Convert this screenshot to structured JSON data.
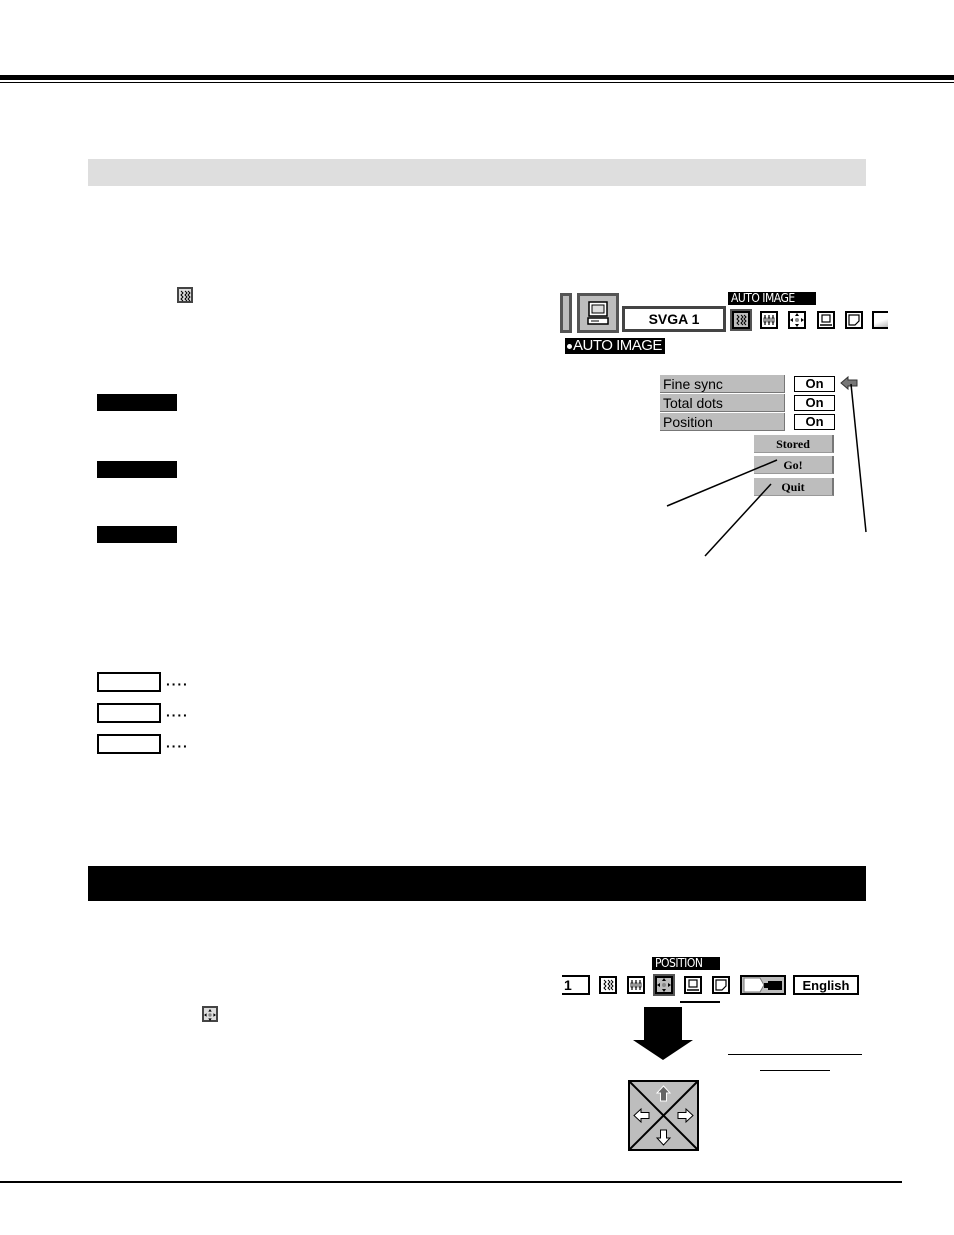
{
  "page": {
    "section_band_top": {
      "label": ""
    },
    "section_band_bottom": {
      "label": ""
    }
  },
  "auto_image_section": {
    "inline_icon": "fine-sync-icon",
    "label_blocks": [
      "",
      "",
      ""
    ],
    "legend_boxes": [
      {
        "box_label": "",
        "leader": "····"
      },
      {
        "box_label": "",
        "leader": "····"
      },
      {
        "box_label": "",
        "leader": "····"
      }
    ],
    "osd": {
      "menu_title": "AUTO IMAGE",
      "source_label": "SVGA 1",
      "submenu_title": "AUTO IMAGE",
      "toolbar_icons": [
        "pc-adjust-icon",
        "fine-sync-icon",
        "total-dots-icon",
        "position-icon",
        "image-level-icon",
        "screen-icon",
        "setting-icon"
      ],
      "rows": [
        {
          "label": "Fine sync",
          "value": "On"
        },
        {
          "label": "Total dots",
          "value": "On"
        },
        {
          "label": "Position",
          "value": "On"
        }
      ],
      "buttons": {
        "stored": "Stored",
        "go": "Go!",
        "quit": "Quit"
      },
      "pointer_icon": "arrow-left-icon"
    }
  },
  "position_section": {
    "inline_icon": "position-icon",
    "osd": {
      "menu_title": "POSITION",
      "source_fragment": "1",
      "toolbar_icons": [
        "fine-sync-icon",
        "total-dots-icon",
        "position-icon",
        "image-level-icon",
        "screen-icon",
        "setting-icon"
      ],
      "language": "English",
      "arrow_icon": "arrow-down-icon",
      "dpad_icons": [
        "arrow-up-icon",
        "arrow-left-icon",
        "arrow-right-icon",
        "arrow-down-icon"
      ]
    }
  }
}
